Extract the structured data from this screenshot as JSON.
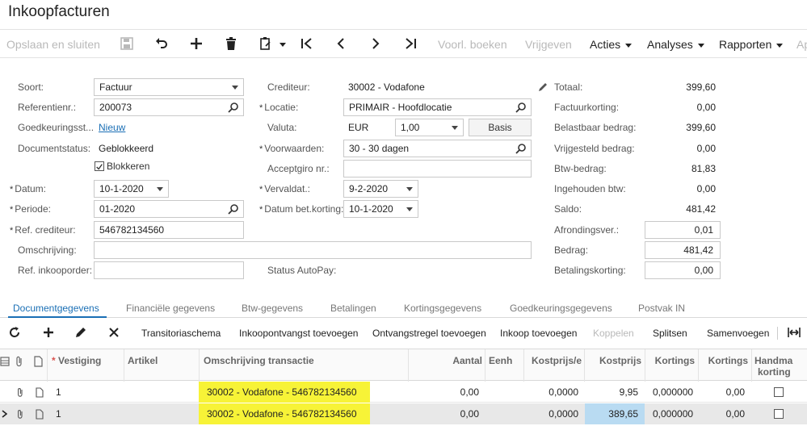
{
  "page": {
    "title": "Inkoopfacturen"
  },
  "toolbar": {
    "save_close": "Opslaan en sluiten",
    "preview_book": "Voorl. boeken",
    "release": "Vrijgeven",
    "actions": "Acties",
    "analyses": "Analyses",
    "reports": "Rapporten",
    "more_cut": "Ap"
  },
  "form": {
    "type_label": "Soort:",
    "type_value": "Factuur",
    "ref_label": "Referentienr.:",
    "ref_value": "200073",
    "approval_label": "Goedkeuringsst...",
    "approval_value": "Nieuw",
    "docstatus_label": "Documentstatus:",
    "docstatus_value": "Geblokkeerd",
    "block_label": "Blokkeren",
    "block_checked": true,
    "date_label": "Datum:",
    "date_value": "10-1-2020",
    "period_label": "Periode:",
    "period_value": "01-2020",
    "vendref_label": "Ref. crediteur:",
    "vendref_value": "546782134560",
    "desc_label": "Omschrijving:",
    "desc_value": "",
    "poref_label": "Ref. inkooporder:",
    "poref_value": "",
    "vendor_label": "Crediteur:",
    "vendor_value": "30002 - Vodafone",
    "location_label": "Locatie:",
    "location_value": "PRIMAIR - Hoofdlocatie",
    "currency_label": "Valuta:",
    "currency_value": "EUR",
    "rate_value": "1,00",
    "basis_label": "Basis",
    "terms_label": "Voorwaarden:",
    "terms_value": "30 - 30 dagen",
    "giro_label": "Acceptgiro nr.:",
    "giro_value": "",
    "due_label": "Vervaldat.:",
    "due_value": "9-2-2020",
    "discdate_label": "Datum bet.korting:",
    "discdate_value": "10-1-2020",
    "autopay_label": "Status AutoPay:"
  },
  "totals": {
    "total_label": "Totaal:",
    "total_value": "399,60",
    "invdisc_label": "Factuurkorting:",
    "invdisc_value": "0,00",
    "taxable_label": "Belastbaar bedrag:",
    "taxable_value": "399,60",
    "exempt_label": "Vrijgesteld bedrag:",
    "exempt_value": "0,00",
    "vat_label": "Btw-bedrag:",
    "vat_value": "81,83",
    "withheld_label": "Ingehouden btw:",
    "withheld_value": "0,00",
    "balance_label": "Saldo:",
    "balance_value": "481,42",
    "rounding_label": "Afrondingsver.:",
    "rounding_value": "0,01",
    "amount_label": "Bedrag:",
    "amount_value": "481,42",
    "paydisc_label": "Betalingskorting:",
    "paydisc_value": "0,00"
  },
  "tabs": [
    "Documentgegevens",
    "Financiële gegevens",
    "Btw-gegevens",
    "Betalingen",
    "Kortingsgegevens",
    "Goedkeuringsgegevens",
    "Postvak IN"
  ],
  "grid_toolbar": {
    "transit": "Transitoriaschema",
    "add_receipt": "Inkoopontvangst toevoegen",
    "add_receipt_line": "Ontvangstregel toevoegen",
    "add_po": "Inkoop toevoegen",
    "link": "Koppelen",
    "split": "Splitsen",
    "merge": "Samenvoegen"
  },
  "grid": {
    "headers": {
      "branch": "Vestiging",
      "item": "Artikel",
      "desc": "Omschrijving transactie",
      "qty": "Aantal",
      "uom": "Eenh",
      "unitcost": "Kostprijs/e",
      "cost": "Kostprijs",
      "disc_pct": "Kortings",
      "disc_amt": "Kortings",
      "manual_line1": "Handma",
      "manual_line2": "korting"
    },
    "rows": [
      {
        "branch": "1",
        "desc": "30002 - Vodafone - 546782134560",
        "qty": "0,00",
        "unitcost": "0,0000",
        "cost": "9,95",
        "disc_pct": "0,000000",
        "disc_amt": "0,00"
      },
      {
        "branch": "1",
        "desc": "30002 - Vodafone - 546782134560",
        "qty": "0,00",
        "unitcost": "0,0000",
        "cost": "389,65",
        "disc_pct": "0,000000",
        "disc_amt": "0,00"
      }
    ]
  },
  "colors": {
    "accent": "#1a6fb5",
    "highlight": "#f7f337",
    "selected_cell": "#b9dbf2"
  }
}
